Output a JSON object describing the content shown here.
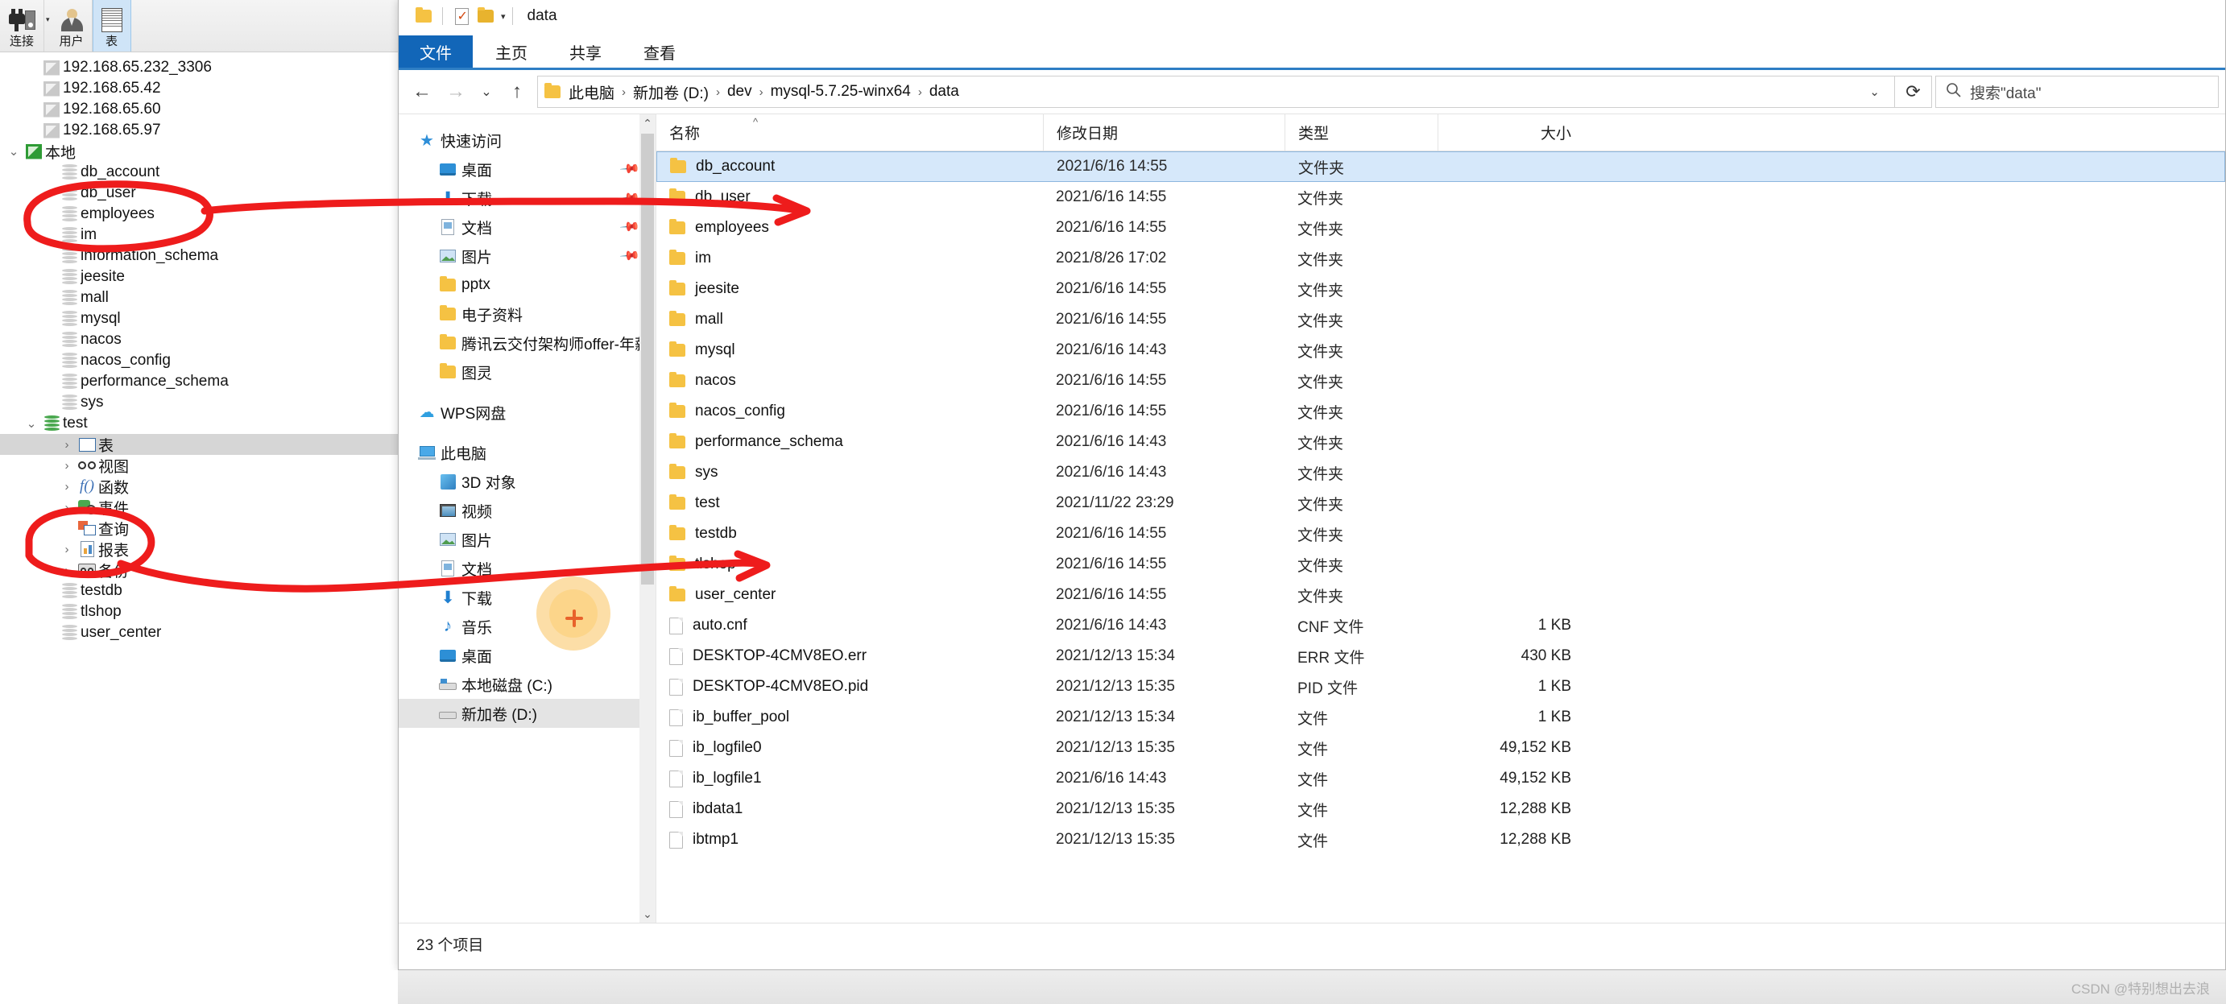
{
  "navicat": {
    "toolbar": [
      {
        "label": "连接",
        "icon": "plug-icon",
        "has_caret": true
      },
      {
        "label": "用户",
        "icon": "user-icon",
        "has_caret": false
      },
      {
        "label": "表",
        "icon": "table-icon",
        "has_caret": false
      }
    ],
    "tree": [
      {
        "label": "192.168.65.232_3306",
        "icon": "connection-icon",
        "indent": 1,
        "chevron": "",
        "state": ""
      },
      {
        "label": "192.168.65.42",
        "icon": "connection-icon",
        "indent": 1,
        "chevron": "",
        "state": ""
      },
      {
        "label": "192.168.65.60",
        "icon": "connection-icon",
        "indent": 1,
        "chevron": "",
        "state": ""
      },
      {
        "label": "192.168.65.97",
        "icon": "connection-icon",
        "indent": 1,
        "chevron": "",
        "state": ""
      },
      {
        "label": "本地",
        "icon": "connection-icon-green",
        "indent": 0,
        "chevron": "⌄",
        "state": "expanded"
      },
      {
        "label": "db_account",
        "icon": "database-icon",
        "indent": 2,
        "chevron": "",
        "state": ""
      },
      {
        "label": "db_user",
        "icon": "database-icon",
        "indent": 2,
        "chevron": "",
        "state": ""
      },
      {
        "label": "employees",
        "icon": "database-icon",
        "indent": 2,
        "chevron": "",
        "state": ""
      },
      {
        "label": "im",
        "icon": "database-icon",
        "indent": 2,
        "chevron": "",
        "state": ""
      },
      {
        "label": "information_schema",
        "icon": "database-icon",
        "indent": 2,
        "chevron": "",
        "state": ""
      },
      {
        "label": "jeesite",
        "icon": "database-icon",
        "indent": 2,
        "chevron": "",
        "state": ""
      },
      {
        "label": "mall",
        "icon": "database-icon",
        "indent": 2,
        "chevron": "",
        "state": ""
      },
      {
        "label": "mysql",
        "icon": "database-icon",
        "indent": 2,
        "chevron": "",
        "state": ""
      },
      {
        "label": "nacos",
        "icon": "database-icon",
        "indent": 2,
        "chevron": "",
        "state": ""
      },
      {
        "label": "nacos_config",
        "icon": "database-icon",
        "indent": 2,
        "chevron": "",
        "state": ""
      },
      {
        "label": "performance_schema",
        "icon": "database-icon",
        "indent": 2,
        "chevron": "",
        "state": ""
      },
      {
        "label": "sys",
        "icon": "database-icon",
        "indent": 2,
        "chevron": "",
        "state": ""
      },
      {
        "label": "test",
        "icon": "database-icon-green",
        "indent": 1,
        "chevron": "⌄",
        "state": "expanded"
      },
      {
        "label": "表",
        "icon": "grid-icon",
        "indent": 3,
        "chevron": "›",
        "state": "selected"
      },
      {
        "label": "视图",
        "icon": "view-icon",
        "indent": 3,
        "chevron": "›",
        "state": ""
      },
      {
        "label": "函数",
        "icon": "function-icon",
        "indent": 3,
        "chevron": "›",
        "state": ""
      },
      {
        "label": "事件",
        "icon": "event-icon",
        "indent": 3,
        "chevron": "›",
        "state": ""
      },
      {
        "label": "查询",
        "icon": "query-icon",
        "indent": 3,
        "chevron": "",
        "state": ""
      },
      {
        "label": "报表",
        "icon": "report-icon",
        "indent": 3,
        "chevron": "›",
        "state": ""
      },
      {
        "label": "备份",
        "icon": "backup-icon",
        "indent": 3,
        "chevron": "›",
        "state": ""
      },
      {
        "label": "testdb",
        "icon": "database-icon",
        "indent": 2,
        "chevron": "",
        "state": ""
      },
      {
        "label": "tlshop",
        "icon": "database-icon",
        "indent": 2,
        "chevron": "",
        "state": ""
      },
      {
        "label": "user_center",
        "icon": "database-icon",
        "indent": 2,
        "chevron": "",
        "state": ""
      }
    ]
  },
  "explorer": {
    "quick_access_title": "data",
    "quick_access_icons": [
      "folder-icon",
      "properties-icon",
      "new-folder-icon",
      "chevron-down-icon"
    ],
    "ribbon_tabs": [
      {
        "label": "文件",
        "active": true
      },
      {
        "label": "主页",
        "active": false
      },
      {
        "label": "共享",
        "active": false
      },
      {
        "label": "查看",
        "active": false
      }
    ],
    "address": {
      "back_icon": "back-arrow-icon",
      "forward_icon": "forward-arrow-icon",
      "history_icon": "chevron-down-icon",
      "up_icon": "up-arrow-icon",
      "refresh_icon": "refresh-icon",
      "crumbs": [
        "此电脑",
        "新加卷 (D:)",
        "dev",
        "mysql-5.7.25-winx64",
        "data"
      ],
      "separator": "›"
    },
    "search": {
      "icon": "search-icon",
      "placeholder": "搜索\"data\""
    },
    "nav_pane": [
      {
        "label": "快速访问",
        "icon": "star-icon",
        "pinned": false,
        "indent": 0,
        "selected": false
      },
      {
        "label": "桌面",
        "icon": "desktop-icon",
        "pinned": true,
        "indent": 1,
        "selected": false
      },
      {
        "label": "下载",
        "icon": "download-icon",
        "pinned": true,
        "indent": 1,
        "selected": false
      },
      {
        "label": "文档",
        "icon": "document-icon",
        "pinned": true,
        "indent": 1,
        "selected": false
      },
      {
        "label": "图片",
        "icon": "pictures-icon",
        "pinned": true,
        "indent": 1,
        "selected": false
      },
      {
        "label": "pptx",
        "icon": "folder-icon",
        "pinned": false,
        "indent": 1,
        "selected": false
      },
      {
        "label": "电子资料",
        "icon": "folder-icon",
        "pinned": false,
        "indent": 1,
        "selected": false
      },
      {
        "label": "腾讯云交付架构师offer-年薪",
        "icon": "folder-icon",
        "pinned": false,
        "indent": 1,
        "selected": false
      },
      {
        "label": "图灵",
        "icon": "folder-icon",
        "pinned": false,
        "indent": 1,
        "selected": false
      },
      {
        "label": "WPS网盘",
        "icon": "cloud-icon",
        "pinned": false,
        "indent": 0,
        "selected": false,
        "gap_before": true
      },
      {
        "label": "此电脑",
        "icon": "computer-icon",
        "pinned": false,
        "indent": 0,
        "selected": false,
        "gap_before": true
      },
      {
        "label": "3D 对象",
        "icon": "3d-objects-icon",
        "pinned": false,
        "indent": 1,
        "selected": false
      },
      {
        "label": "视频",
        "icon": "videos-icon",
        "pinned": false,
        "indent": 1,
        "selected": false
      },
      {
        "label": "图片",
        "icon": "pictures-icon",
        "pinned": false,
        "indent": 1,
        "selected": false
      },
      {
        "label": "文档",
        "icon": "document-icon",
        "pinned": false,
        "indent": 1,
        "selected": false
      },
      {
        "label": "下载",
        "icon": "download-icon",
        "pinned": false,
        "indent": 1,
        "selected": false
      },
      {
        "label": "音乐",
        "icon": "music-icon",
        "pinned": false,
        "indent": 1,
        "selected": false
      },
      {
        "label": "桌面",
        "icon": "desktop-icon",
        "pinned": false,
        "indent": 1,
        "selected": false
      },
      {
        "label": "本地磁盘 (C:)",
        "icon": "disk-icon",
        "pinned": false,
        "indent": 1,
        "selected": false
      },
      {
        "label": "新加卷 (D:)",
        "icon": "disk-plain-icon",
        "pinned": false,
        "indent": 1,
        "selected": true
      }
    ],
    "columns": [
      {
        "label": "名称",
        "key": "name"
      },
      {
        "label": "修改日期",
        "key": "date"
      },
      {
        "label": "类型",
        "key": "type"
      },
      {
        "label": "大小",
        "key": "size"
      }
    ],
    "sort_indicator": "^",
    "files": [
      {
        "name": "db_account",
        "date": "2021/6/16 14:55",
        "type": "文件夹",
        "size": "",
        "kind": "folder",
        "selected": true
      },
      {
        "name": "db_user",
        "date": "2021/6/16 14:55",
        "type": "文件夹",
        "size": "",
        "kind": "folder",
        "selected": false
      },
      {
        "name": "employees",
        "date": "2021/6/16 14:55",
        "type": "文件夹",
        "size": "",
        "kind": "folder",
        "selected": false
      },
      {
        "name": "im",
        "date": "2021/8/26 17:02",
        "type": "文件夹",
        "size": "",
        "kind": "folder",
        "selected": false
      },
      {
        "name": "jeesite",
        "date": "2021/6/16 14:55",
        "type": "文件夹",
        "size": "",
        "kind": "folder",
        "selected": false
      },
      {
        "name": "mall",
        "date": "2021/6/16 14:55",
        "type": "文件夹",
        "size": "",
        "kind": "folder",
        "selected": false
      },
      {
        "name": "mysql",
        "date": "2021/6/16 14:43",
        "type": "文件夹",
        "size": "",
        "kind": "folder",
        "selected": false
      },
      {
        "name": "nacos",
        "date": "2021/6/16 14:55",
        "type": "文件夹",
        "size": "",
        "kind": "folder",
        "selected": false
      },
      {
        "name": "nacos_config",
        "date": "2021/6/16 14:55",
        "type": "文件夹",
        "size": "",
        "kind": "folder",
        "selected": false
      },
      {
        "name": "performance_schema",
        "date": "2021/6/16 14:43",
        "type": "文件夹",
        "size": "",
        "kind": "folder",
        "selected": false
      },
      {
        "name": "sys",
        "date": "2021/6/16 14:43",
        "type": "文件夹",
        "size": "",
        "kind": "folder",
        "selected": false
      },
      {
        "name": "test",
        "date": "2021/11/22 23:29",
        "type": "文件夹",
        "size": "",
        "kind": "folder",
        "selected": false
      },
      {
        "name": "testdb",
        "date": "2021/6/16 14:55",
        "type": "文件夹",
        "size": "",
        "kind": "folder",
        "selected": false
      },
      {
        "name": "tlshop",
        "date": "2021/6/16 14:55",
        "type": "文件夹",
        "size": "",
        "kind": "folder",
        "selected": false
      },
      {
        "name": "user_center",
        "date": "2021/6/16 14:55",
        "type": "文件夹",
        "size": "",
        "kind": "folder",
        "selected": false
      },
      {
        "name": "auto.cnf",
        "date": "2021/6/16 14:43",
        "type": "CNF 文件",
        "size": "1 KB",
        "kind": "file",
        "selected": false
      },
      {
        "name": "DESKTOP-4CMV8EO.err",
        "date": "2021/12/13 15:34",
        "type": "ERR 文件",
        "size": "430 KB",
        "kind": "file",
        "selected": false
      },
      {
        "name": "DESKTOP-4CMV8EO.pid",
        "date": "2021/12/13 15:35",
        "type": "PID 文件",
        "size": "1 KB",
        "kind": "file",
        "selected": false
      },
      {
        "name": "ib_buffer_pool",
        "date": "2021/12/13 15:34",
        "type": "文件",
        "size": "1 KB",
        "kind": "file",
        "selected": false
      },
      {
        "name": "ib_logfile0",
        "date": "2021/12/13 15:35",
        "type": "文件",
        "size": "49,152 KB",
        "kind": "file",
        "selected": false
      },
      {
        "name": "ib_logfile1",
        "date": "2021/6/16 14:43",
        "type": "文件",
        "size": "49,152 KB",
        "kind": "file",
        "selected": false
      },
      {
        "name": "ibdata1",
        "date": "2021/12/13 15:35",
        "type": "文件",
        "size": "12,288 KB",
        "kind": "file",
        "selected": false
      },
      {
        "name": "ibtmp1",
        "date": "2021/12/13 15:35",
        "type": "文件",
        "size": "12,288 KB",
        "kind": "file",
        "selected": false
      }
    ],
    "status": "23 个项目"
  },
  "annotations": {
    "color": "#ee1c1c",
    "watermark": "CSDN @特别想出去浪"
  }
}
